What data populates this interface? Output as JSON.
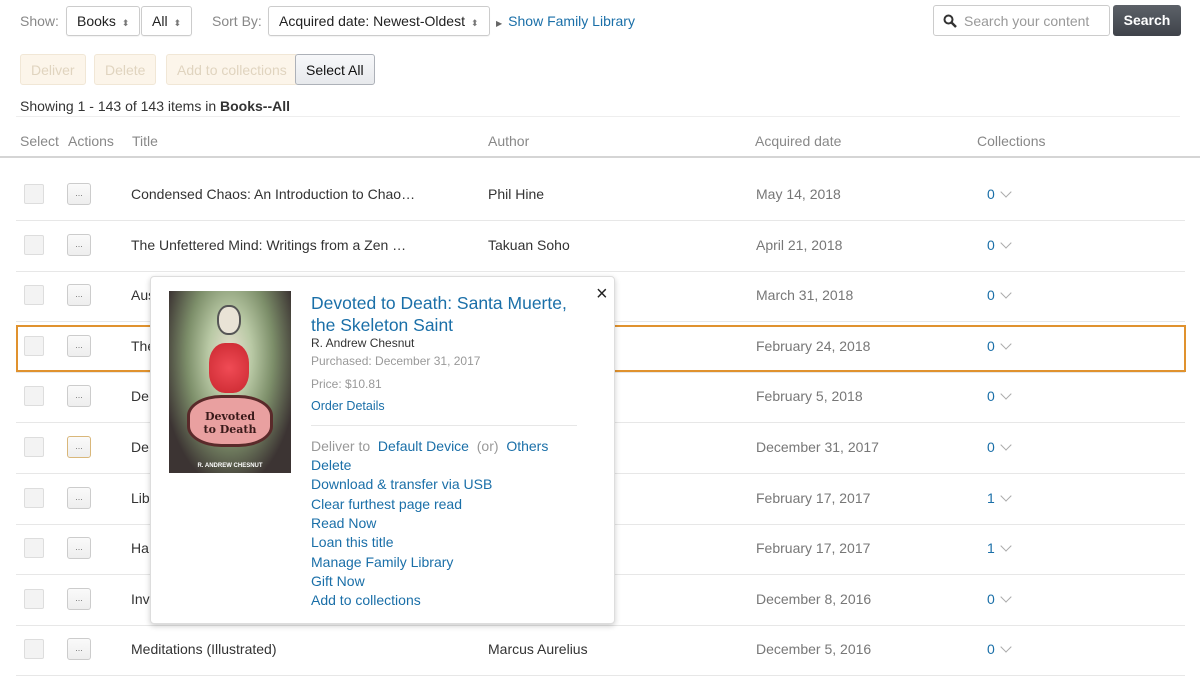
{
  "toolbar": {
    "show_label": "Show:",
    "show_value": "Books",
    "filter_value": "All",
    "sort_label": "Sort By:",
    "sort_value": "Acquired date: Newest-Oldest",
    "family_link": "Show Family Library",
    "search_placeholder": "Search your content",
    "search_button": "Search"
  },
  "actions": {
    "deliver": "Deliver",
    "delete": "Delete",
    "add_collections": "Add to collections",
    "select_all": "Select All"
  },
  "summary": {
    "prefix": "Showing 1 - 143 of 143 items in ",
    "category": "Books--All"
  },
  "columns": {
    "select": "Select",
    "actions": "Actions",
    "title": "Title",
    "author": "Author",
    "date": "Acquired date",
    "collections": "Collections"
  },
  "rows": [
    {
      "title": "Condensed Chaos: An Introduction to Chao…",
      "author": "Phil Hine",
      "date": "May 14, 2018",
      "collections": "0"
    },
    {
      "title": "The Unfettered Mind: Writings from a Zen …",
      "author": "Takuan Soho",
      "date": "April 21, 2018",
      "collections": "0"
    },
    {
      "title": "Aus",
      "author": "",
      "date": "March 31, 2018",
      "collections": "0"
    },
    {
      "title": "The",
      "author": "",
      "date": "February 24, 2018",
      "collections": "0"
    },
    {
      "title": "De",
      "author": "",
      "date": "February 5, 2018",
      "collections": "0"
    },
    {
      "title": "De",
      "author": "",
      "date": "December 31, 2017",
      "collections": "0"
    },
    {
      "title": "Lib",
      "author": "",
      "date": "February 17, 2017",
      "collections": "1"
    },
    {
      "title": "Ha",
      "author": "",
      "date": "February 17, 2017",
      "collections": "1"
    },
    {
      "title": "Inv",
      "author": "",
      "date": "December 8, 2016",
      "collections": "0"
    },
    {
      "title": "Meditations (Illustrated)",
      "author": "Marcus Aurelius",
      "date": "December 5, 2016",
      "collections": "0"
    }
  ],
  "popover": {
    "title": "Devoted to Death: Santa Muerte, the Skeleton Saint",
    "author": "R. Andrew Chesnut",
    "purchased": "Purchased: December 31, 2017",
    "price": "Price: $10.81",
    "order_details": "Order Details",
    "deliver_to": "Deliver to",
    "default_device": "Default Device",
    "or": "(or)",
    "others": "Others",
    "links": [
      "Delete",
      "Download & transfer via USB",
      "Clear furthest page read",
      "Read Now",
      "Loan this title",
      "Manage Family Library",
      "Gift Now",
      "Add to collections"
    ],
    "cover_text": {
      "title": "Devoted to Death",
      "author": "R. ANDREW CHESNUT"
    }
  },
  "colors": {
    "link": "#1a6fa8",
    "highlight_border": "#e0922e",
    "search_button": "#4a4f55"
  }
}
